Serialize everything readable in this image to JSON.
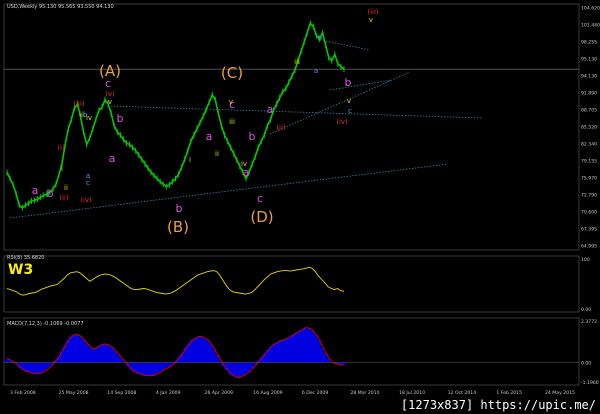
{
  "header": {
    "symbol_line": "USD,Weekly  95.130 95.565 93.550 94.130"
  },
  "rsi": {
    "label": "RSI(8) 35.6820",
    "tag": "W3",
    "levels": [
      "100",
      "0.00"
    ]
  },
  "macd": {
    "label": "MACD(7,12,3) -0.1069 -0.0077",
    "levels": [
      "2.3772",
      "0.00",
      "-1.1960"
    ]
  },
  "watermark": "[1273x837] https://upic.me/",
  "colors": {
    "price": "#00c800",
    "rsi": "#e8d800",
    "hist": "#0000e0",
    "signal": "#e00000",
    "grid": "#606060",
    "trend": "#2a8a9a"
  },
  "chart_data": {
    "type": "line",
    "title": "USD,Weekly 95.130 95.565 93.550 94.130",
    "y_ticks": [
      "104.620",
      "101.440",
      "98.255",
      "95.130",
      "94.130",
      "91.890",
      "88.705",
      "85.520",
      "82.340",
      "79.155",
      "75.970",
      "72.790",
      "70.600",
      "67.395",
      "64.995"
    ],
    "x_ticks": [
      "3 Feb 2008",
      "25 May 2008",
      "14 Sep 2008",
      "4 Jan 2009",
      "26 Apr 2009",
      "16 Aug 2009",
      "6 Dec 2009",
      "28 Mar 2010",
      "18 Jul 2010",
      "12 Oct 2014",
      "1 Feb 2015",
      "24 May 2015"
    ],
    "ylim": [
      64.995,
      104.62
    ],
    "series": [
      {
        "values": [
          77.5,
          76.5,
          75.5,
          74.0,
          72.2,
          71.8,
          72.2,
          72.5,
          72.9,
          73.0,
          73.2,
          73.5,
          73.8,
          74.0,
          74.3,
          74.8,
          75.6,
          77.2,
          79.0,
          82.0,
          84.5,
          86.0,
          87.8,
          88.5,
          86.5,
          84.0,
          82.0,
          83.0,
          84.5,
          86.0,
          87.5,
          88.0,
          89.2,
          88.5,
          87.0,
          85.0,
          84.0,
          83.5,
          82.8,
          82.2,
          82.0,
          81.5,
          81.0,
          80.3,
          79.6,
          78.9,
          78.2,
          77.5,
          77.0,
          76.5,
          76.0,
          75.6,
          75.2,
          75.5,
          76.0,
          76.5,
          77.2,
          78.3,
          79.6,
          81.0,
          82.5,
          83.5,
          84.5,
          85.5,
          86.5,
          87.6,
          88.8,
          90.0,
          89.2,
          87.0,
          85.0,
          83.5,
          82.5,
          81.5,
          80.5,
          79.5,
          78.5,
          77.5,
          76.5,
          77.5,
          78.8,
          80.0,
          81.5,
          82.5,
          83.5,
          85.0,
          86.0,
          87.5,
          88.5,
          89.5,
          90.5,
          91.0,
          92.0,
          93.0,
          94.0,
          95.5,
          97.0,
          98.5,
          100.0,
          101.5,
          101.0,
          99.5,
          99.0,
          100.0,
          98.0,
          96.0,
          95.5,
          96.5,
          95.0,
          94.5,
          94.13
        ]
      }
    ],
    "waves": [
      {
        "text": "(A)",
        "color": "#e8a040",
        "size": "big"
      },
      {
        "text": "(C)",
        "color": "#e8a040",
        "size": "big"
      },
      {
        "text": "(B)",
        "color": "#e8a040",
        "size": "big"
      },
      {
        "text": "(D)",
        "color": "#e8a040",
        "size": "big"
      },
      {
        "text": "c",
        "color": "#e050e0",
        "size": "mid"
      },
      {
        "text": "c",
        "color": "#e050e0",
        "size": "mid"
      },
      {
        "text": "c",
        "color": "#e050e0",
        "size": "mid"
      },
      {
        "text": "b",
        "color": "#e050e0",
        "size": "mid"
      },
      {
        "text": "b",
        "color": "#e050e0",
        "size": "mid"
      },
      {
        "text": "b",
        "color": "#e050e0",
        "size": "mid"
      },
      {
        "text": "b",
        "color": "#e050e0",
        "size": "mid"
      },
      {
        "text": "b",
        "color": "#e050e0",
        "size": "mid"
      },
      {
        "text": "a",
        "color": "#e050e0",
        "size": "mid"
      },
      {
        "text": "a",
        "color": "#e050e0",
        "size": "mid"
      },
      {
        "text": "a",
        "color": "#e050e0",
        "size": "mid"
      },
      {
        "text": "a",
        "color": "#e050e0",
        "size": "mid"
      },
      {
        "text": "a",
        "color": "#e050e0",
        "size": "mid"
      },
      {
        "text": "(iii)",
        "color": "#e03030",
        "size": "sm"
      },
      {
        "text": "(iii)",
        "color": "#e03030",
        "size": "sm"
      },
      {
        "text": "(v)",
        "color": "#e03030",
        "size": "sm"
      },
      {
        "text": "(i)",
        "color": "#e03030",
        "size": "sm"
      },
      {
        "text": "(ii)",
        "color": "#e03030",
        "size": "sm"
      },
      {
        "text": "(iv)",
        "color": "#e03030",
        "size": "sm"
      },
      {
        "text": "(ii)",
        "color": "#e03030",
        "size": "sm"
      },
      {
        "text": "(iv)",
        "color": "#e03030",
        "size": "sm"
      },
      {
        "text": "v",
        "color": "#e8d800",
        "size": "sm"
      },
      {
        "text": "v",
        "color": "#e8d800",
        "size": "sm"
      },
      {
        "text": "v",
        "color": "#e8d800",
        "size": "sm"
      },
      {
        "text": "v",
        "color": "#e8d800",
        "size": "sm"
      },
      {
        "text": "iv",
        "color": "#e8d800",
        "size": "sm"
      },
      {
        "text": "iv",
        "color": "#e8d800",
        "size": "sm"
      },
      {
        "text": "iii",
        "color": "#e8d800",
        "size": "sm"
      },
      {
        "text": "iii",
        "color": "#e8d800",
        "size": "sm"
      },
      {
        "text": "iii",
        "color": "#e8d800",
        "size": "sm"
      },
      {
        "text": "ii",
        "color": "#e8d800",
        "size": "sm"
      },
      {
        "text": "ii",
        "color": "#e8d800",
        "size": "sm"
      },
      {
        "text": "i",
        "color": "#e8d800",
        "size": "sm"
      },
      {
        "text": "i",
        "color": "#e8d800",
        "size": "sm"
      },
      {
        "text": "b",
        "color": "#40a0f0",
        "size": "sm"
      },
      {
        "text": "b",
        "color": "#40a0f0",
        "size": "sm"
      },
      {
        "text": "c",
        "color": "#40a0f0",
        "size": "sm"
      },
      {
        "text": "c",
        "color": "#40a0f0",
        "size": "sm"
      },
      {
        "text": "a",
        "color": "#40a0f0",
        "size": "sm"
      },
      {
        "text": "a",
        "color": "#40a0f0",
        "size": "sm"
      }
    ],
    "rsi_values": [
      42,
      40,
      38,
      36,
      32,
      30,
      31,
      33,
      34,
      35,
      38,
      41,
      43,
      45,
      47,
      48,
      50,
      55,
      60,
      66,
      70,
      71,
      72,
      70,
      65,
      60,
      55,
      58,
      62,
      65,
      67,
      68,
      67,
      65,
      62,
      58,
      54,
      50,
      46,
      42,
      40,
      40,
      41,
      42,
      41,
      39,
      37,
      35,
      34,
      33,
      32,
      33,
      35,
      38,
      42,
      46,
      50,
      54,
      58,
      62,
      66,
      68,
      70,
      72,
      73,
      74,
      72,
      65,
      56,
      47,
      40,
      36,
      35,
      34,
      33,
      32,
      33,
      35,
      40,
      46,
      52,
      58,
      63,
      68,
      70,
      72,
      73,
      74,
      74,
      73,
      74,
      75,
      76,
      77,
      78,
      80,
      78,
      72,
      64,
      58,
      52,
      45,
      42,
      40,
      42,
      38,
      37
    ],
    "macd_values": [
      0.2,
      0.1,
      0.0,
      -0.1,
      -0.3,
      -0.4,
      -0.5,
      -0.5,
      -0.6,
      -0.6,
      -0.6,
      -0.5,
      -0.4,
      -0.3,
      -0.1,
      0.1,
      0.3,
      0.6,
      0.9,
      1.2,
      1.4,
      1.5,
      1.5,
      1.4,
      1.2,
      1.0,
      0.8,
      0.7,
      0.8,
      0.9,
      1.0,
      1.0,
      0.9,
      0.8,
      0.6,
      0.4,
      0.2,
      0.0,
      -0.2,
      -0.4,
      -0.5,
      -0.6,
      -0.6,
      -0.7,
      -0.7,
      -0.7,
      -0.7,
      -0.6,
      -0.5,
      -0.4,
      -0.3,
      -0.2,
      -0.1,
      0.1,
      0.3,
      0.5,
      0.8,
      1.0,
      1.2,
      1.3,
      1.4,
      1.4,
      1.3,
      1.2,
      1.0,
      0.7,
      0.4,
      0.1,
      -0.2,
      -0.4,
      -0.6,
      -0.7,
      -0.8,
      -0.8,
      -0.7,
      -0.6,
      -0.5,
      -0.3,
      -0.1,
      0.1,
      0.3,
      0.5,
      0.7,
      0.9,
      1.0,
      1.1,
      1.2,
      1.2,
      1.3,
      1.4,
      1.5,
      1.6,
      1.7,
      1.8,
      1.9,
      1.8,
      1.7,
      1.5,
      1.2,
      0.8,
      0.5,
      0.2,
      0.0,
      -0.05,
      -0.1,
      -0.15,
      -0.1
    ]
  }
}
